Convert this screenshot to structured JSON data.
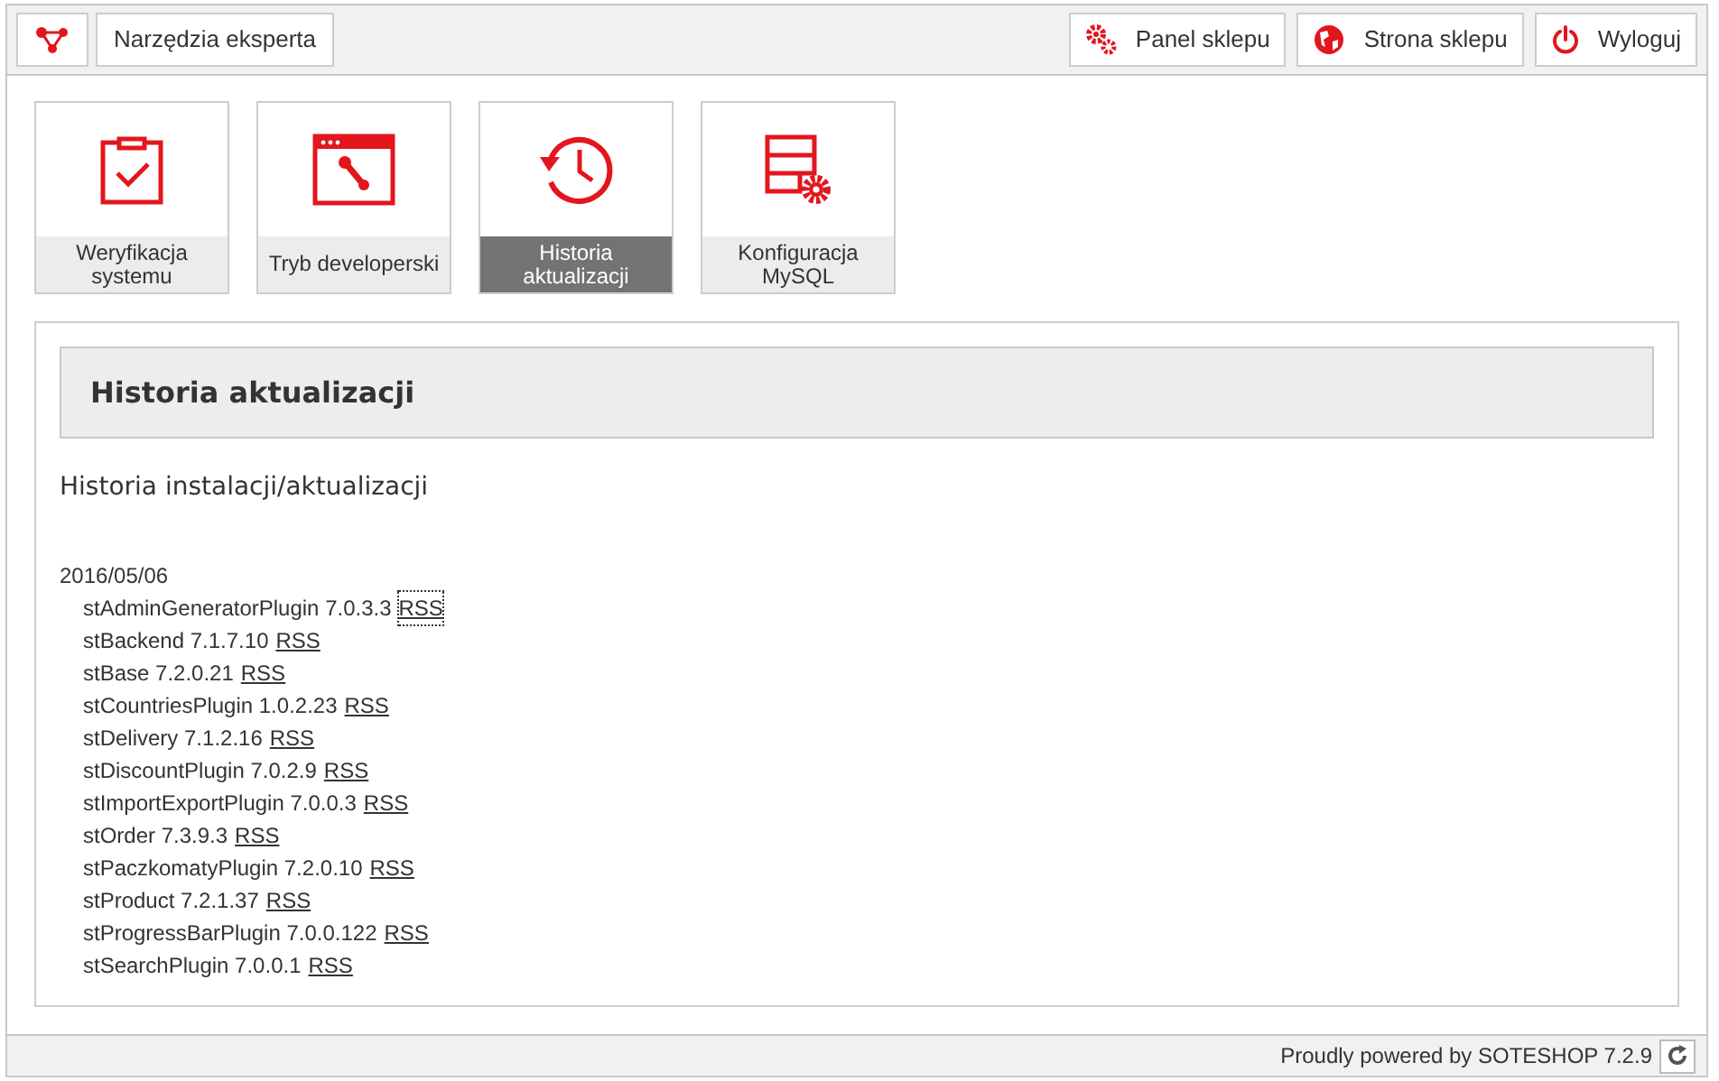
{
  "top_bar": {
    "title": "Narzędzia eksperta",
    "buttons": [
      {
        "kind": "gears",
        "label": "Panel sklepu"
      },
      {
        "kind": "globe",
        "label": "Strona sklepu"
      },
      {
        "kind": "power",
        "label": "Wyloguj"
      }
    ]
  },
  "tiles": [
    {
      "kind": "clipboard",
      "label": "Weryfikacja systemu",
      "selected": false
    },
    {
      "kind": "window",
      "label": "Tryb developerski",
      "selected": false
    },
    {
      "kind": "history",
      "label": "Historia aktualizacji",
      "selected": true
    },
    {
      "kind": "database",
      "label": "Konfiguracja MySQL",
      "selected": false
    }
  ],
  "panel": {
    "heading": "Historia aktualizacji",
    "subheading": "Historia instalacji/aktualizacji",
    "date": "2016/05/06",
    "entries": [
      {
        "text": "stAdminGeneratorPlugin 7.0.3.3",
        "link": "RSS",
        "focused": true
      },
      {
        "text": "stBackend 7.1.7.10",
        "link": "RSS",
        "focused": false
      },
      {
        "text": "stBase 7.2.0.21",
        "link": "RSS",
        "focused": false
      },
      {
        "text": "stCountriesPlugin 1.0.2.23",
        "link": "RSS",
        "focused": false
      },
      {
        "text": "stDelivery 7.1.2.16",
        "link": "RSS",
        "focused": false
      },
      {
        "text": "stDiscountPlugin 7.0.2.9",
        "link": "RSS",
        "focused": false
      },
      {
        "text": "stImportExportPlugin 7.0.0.3",
        "link": "RSS",
        "focused": false
      },
      {
        "text": "stOrder 7.3.9.3",
        "link": "RSS",
        "focused": false
      },
      {
        "text": "stPaczkomatyPlugin 7.2.0.10",
        "link": "RSS",
        "focused": false
      },
      {
        "text": "stProduct 7.2.1.37",
        "link": "RSS",
        "focused": false
      },
      {
        "text": "stProgressBarPlugin 7.0.0.122",
        "link": "RSS",
        "focused": false
      },
      {
        "text": "stSearchPlugin 7.0.0.1",
        "link": "RSS",
        "focused": false
      }
    ]
  },
  "footer": {
    "text": "Proudly powered by SOTESHOP 7.2.9"
  }
}
